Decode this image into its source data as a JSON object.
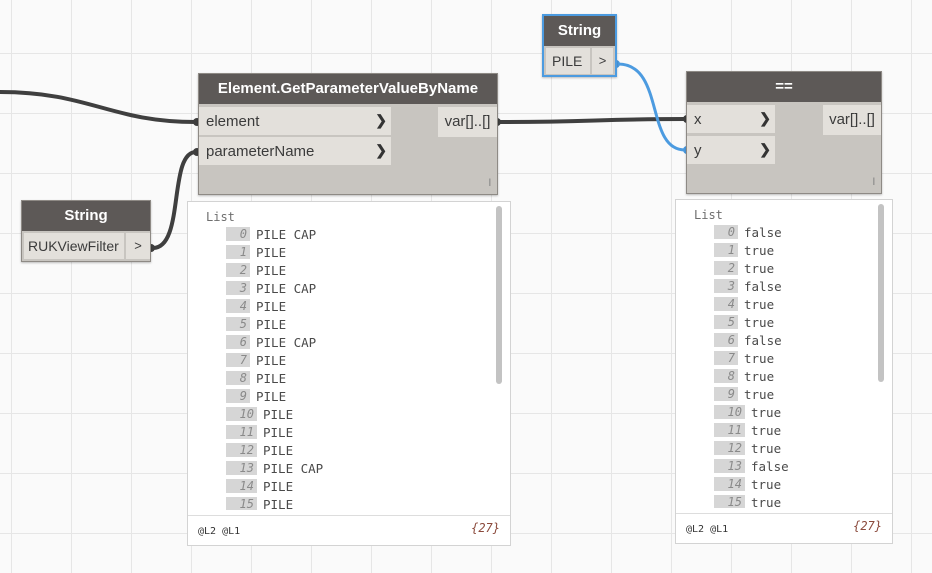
{
  "nodes": {
    "get_param": {
      "title": "Element.GetParameterValueByName",
      "inputs": [
        "element",
        "parameterName"
      ],
      "output": "var[]..[]",
      "lacing": "l"
    },
    "equals": {
      "title": "==",
      "inputs": [
        "x",
        "y"
      ],
      "output": "var[]..[]",
      "lacing": "l"
    },
    "string_rukview": {
      "title": "String",
      "value": "RUKViewFilter",
      "output": ">"
    },
    "string_pile": {
      "title": "String",
      "value": "PILE",
      "output": ">"
    }
  },
  "preview_left": {
    "title": "List",
    "items": [
      {
        "index": "0",
        "value": "PILE CAP"
      },
      {
        "index": "1",
        "value": "PILE"
      },
      {
        "index": "2",
        "value": "PILE"
      },
      {
        "index": "3",
        "value": "PILE CAP"
      },
      {
        "index": "4",
        "value": "PILE"
      },
      {
        "index": "5",
        "value": "PILE"
      },
      {
        "index": "6",
        "value": "PILE CAP"
      },
      {
        "index": "7",
        "value": "PILE"
      },
      {
        "index": "8",
        "value": "PILE"
      },
      {
        "index": "9",
        "value": "PILE"
      },
      {
        "index": "10",
        "value": "PILE"
      },
      {
        "index": "11",
        "value": "PILE"
      },
      {
        "index": "12",
        "value": "PILE"
      },
      {
        "index": "13",
        "value": "PILE CAP"
      },
      {
        "index": "14",
        "value": "PILE"
      },
      {
        "index": "15",
        "value": "PILE"
      }
    ],
    "levels": "@L2 @L1",
    "count": "{27}"
  },
  "preview_right": {
    "title": "List",
    "items": [
      {
        "index": "0",
        "value": "false"
      },
      {
        "index": "1",
        "value": "true"
      },
      {
        "index": "2",
        "value": "true"
      },
      {
        "index": "3",
        "value": "false"
      },
      {
        "index": "4",
        "value": "true"
      },
      {
        "index": "5",
        "value": "true"
      },
      {
        "index": "6",
        "value": "false"
      },
      {
        "index": "7",
        "value": "true"
      },
      {
        "index": "8",
        "value": "true"
      },
      {
        "index": "9",
        "value": "true"
      },
      {
        "index": "10",
        "value": "true"
      },
      {
        "index": "11",
        "value": "true"
      },
      {
        "index": "12",
        "value": "true"
      },
      {
        "index": "13",
        "value": "false"
      },
      {
        "index": "14",
        "value": "true"
      },
      {
        "index": "15",
        "value": "true"
      }
    ],
    "levels": "@L2 @L1",
    "count": "{27}"
  },
  "colors": {
    "wire": "#3f3f3f",
    "wire_selected": "#4c9be0",
    "node_header": "#5d5957",
    "node_body": "#c8c5c0",
    "port": "#e3e0db",
    "count_text": "#8b4a3c"
  }
}
